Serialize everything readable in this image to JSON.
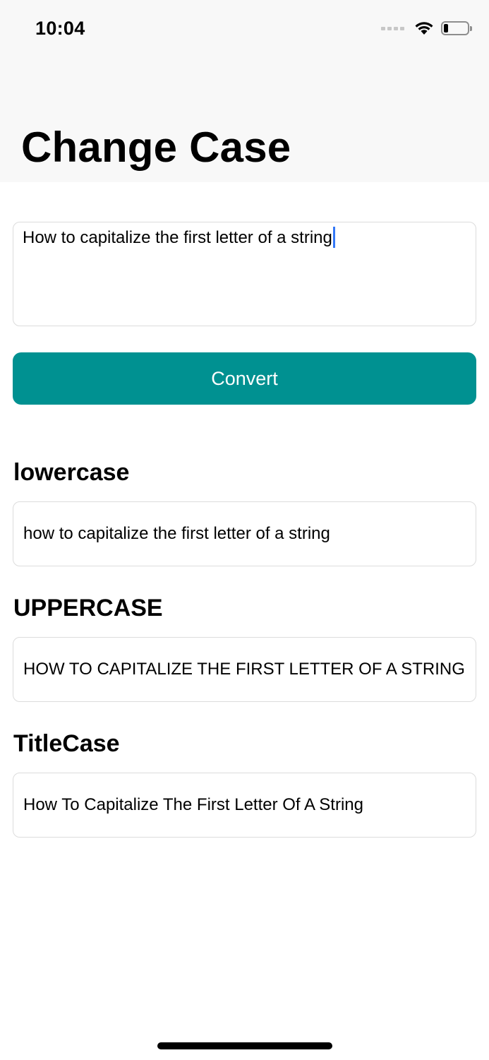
{
  "status_bar": {
    "time": "10:04",
    "battery_level": 0.2
  },
  "header": {
    "title": "Change Case"
  },
  "input": {
    "value": "How to capitalize the first letter of a string"
  },
  "convert_button": {
    "label": "Convert",
    "color": "#009191"
  },
  "results": {
    "lowercase": {
      "label": "lowercase",
      "value": "how to capitalize the first letter of a string"
    },
    "uppercase": {
      "label": "UPPERCASE",
      "value": "HOW TO CAPITALIZE THE FIRST LETTER OF A STRING"
    },
    "titlecase": {
      "label": "TitleCase",
      "value": "How To Capitalize The First Letter Of A String"
    }
  },
  "icons": {
    "signal": "signal-dots-icon",
    "wifi": "wifi-icon",
    "battery": "battery-icon"
  },
  "colors": {
    "caret": "#3478f6",
    "nav_background": "#f8f8f8"
  }
}
